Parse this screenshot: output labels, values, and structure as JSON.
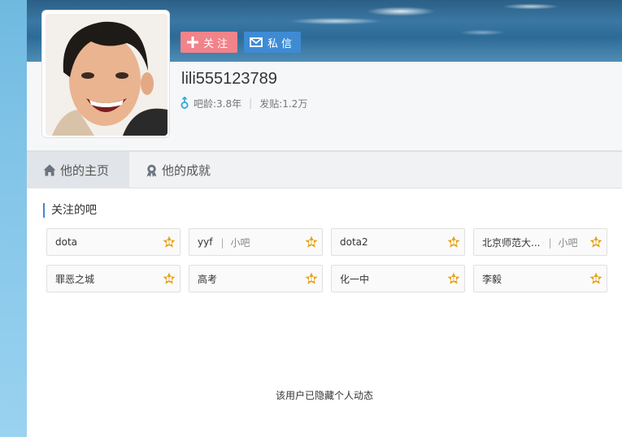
{
  "profile": {
    "follow_label": "关注",
    "message_label": "私信",
    "username": "lili555123789",
    "age_label": "吧龄:3.8年",
    "sep": "|",
    "posts_label": "发贴:1.2万"
  },
  "tabs": [
    {
      "label": "他的主页",
      "icon": "home-icon",
      "active": true
    },
    {
      "label": "他的成就",
      "icon": "medal-icon",
      "active": false
    }
  ],
  "section": {
    "title": "关注的吧"
  },
  "bars": [
    {
      "name": "dota",
      "tag": ""
    },
    {
      "name": "yyf",
      "tag": "小吧"
    },
    {
      "name": "dota2",
      "tag": ""
    },
    {
      "name": "北京师范大...",
      "tag": "小吧"
    },
    {
      "name": "罪恶之城",
      "tag": ""
    },
    {
      "name": "高考",
      "tag": ""
    },
    {
      "name": "化一中",
      "tag": ""
    },
    {
      "name": "李毅",
      "tag": ""
    }
  ],
  "bar_level_badge": "star-badge-icon",
  "hidden_message": "该用户已隐藏个人动态",
  "colors": {
    "follow": "#f1838a",
    "message": "#3e8bd4",
    "accent": "#3e8bd4",
    "badge": "#e8a317"
  }
}
